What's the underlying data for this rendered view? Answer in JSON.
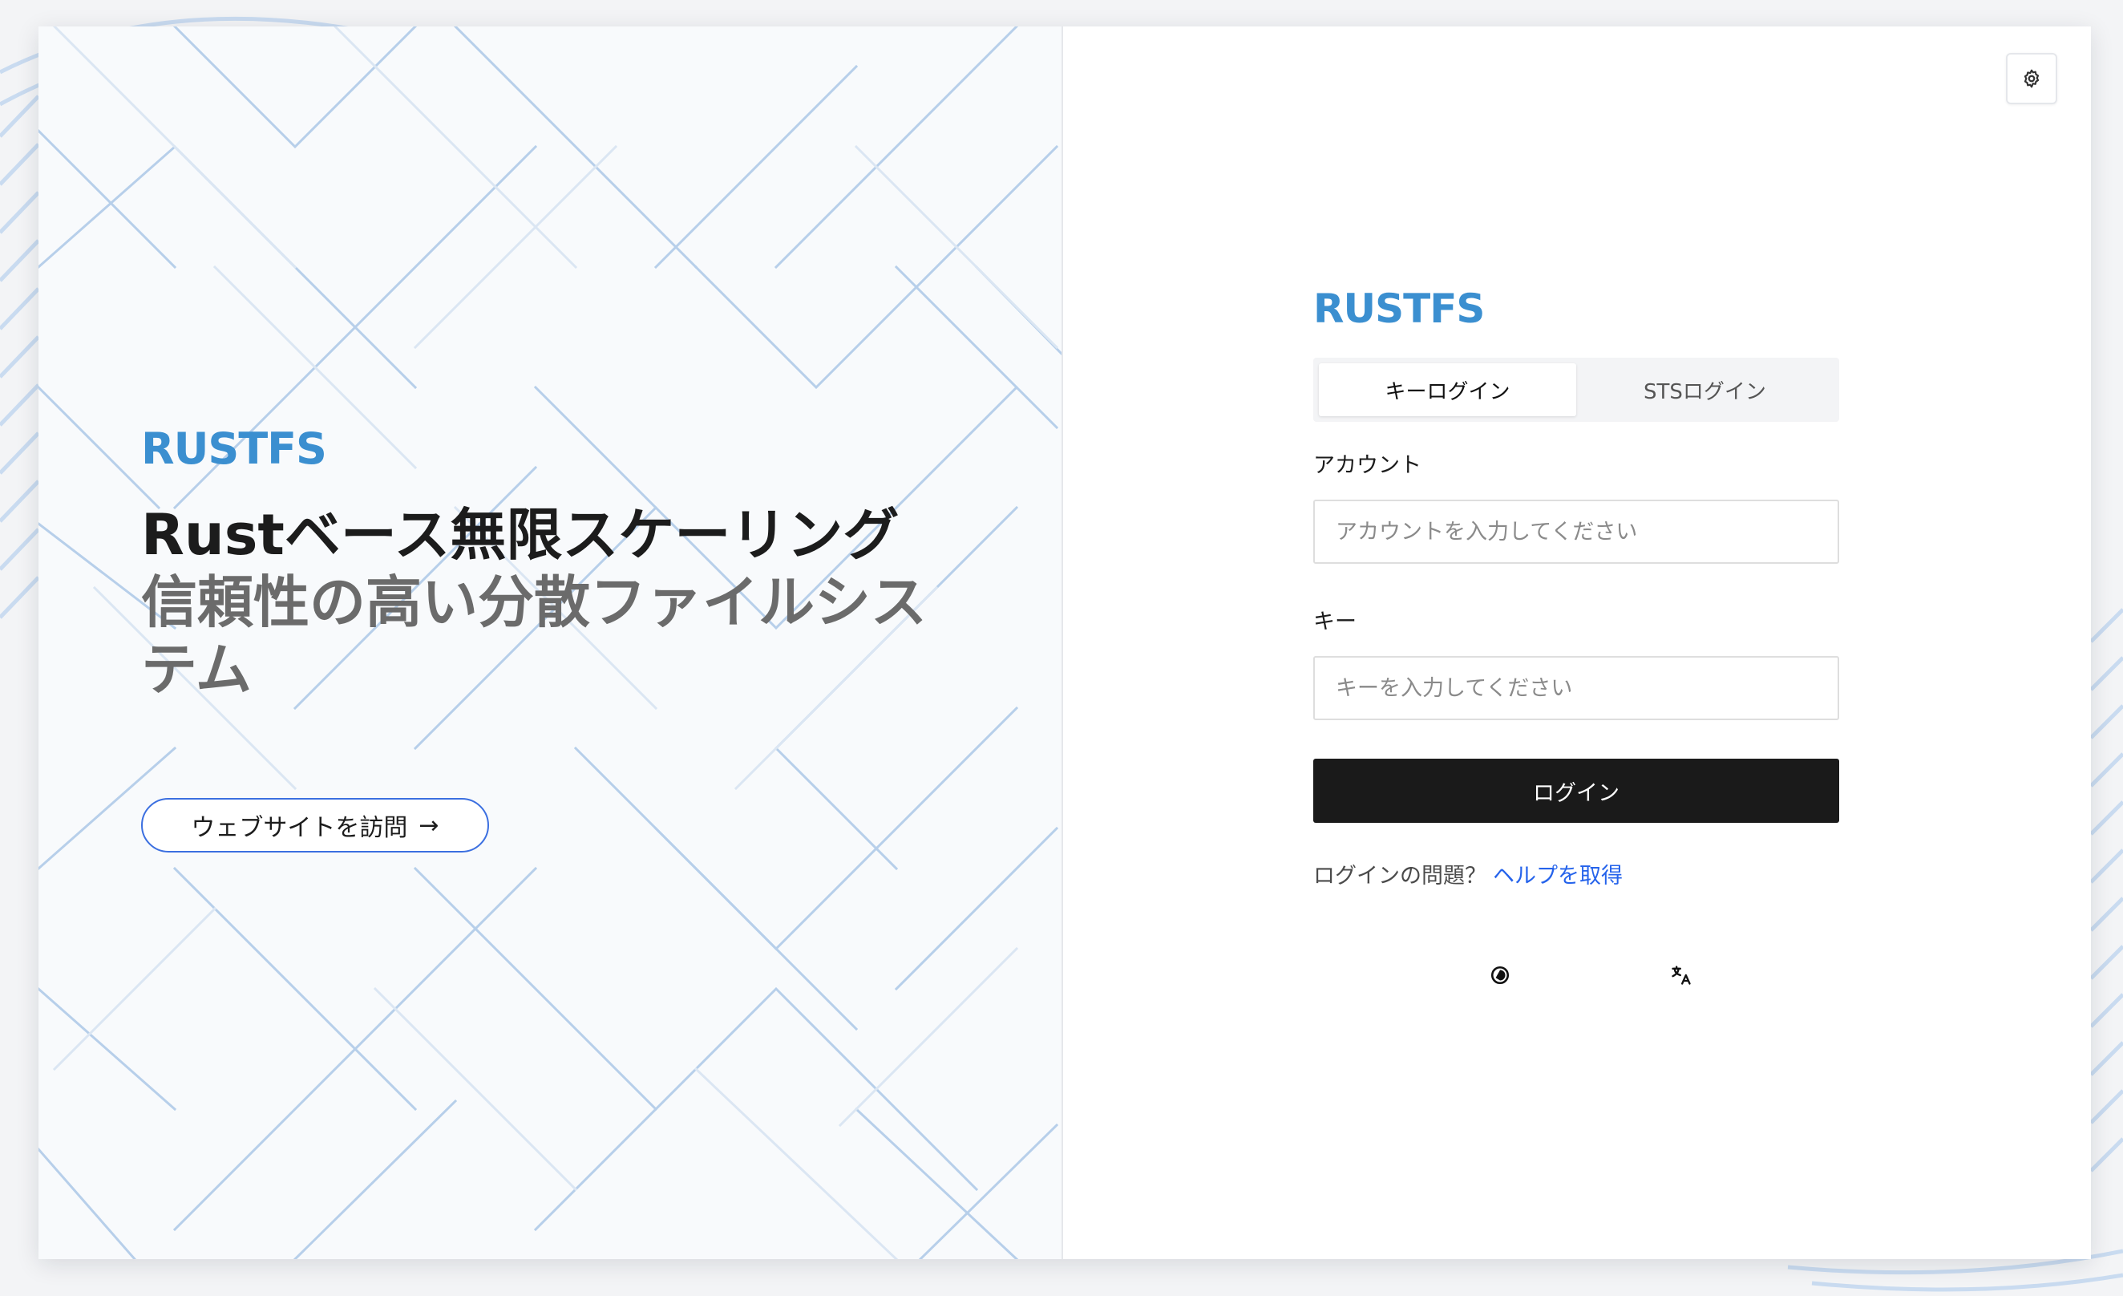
{
  "brand": {
    "name": "RUSTFS",
    "color": "#3b8fd0"
  },
  "hero": {
    "title": "Rustベース無限スケーリング",
    "subtitle": "信頼性の高い分散ファイルシステム",
    "visit_label": "ウェブサイトを訪問",
    "visit_arrow": "→"
  },
  "login": {
    "tabs": [
      {
        "label": "キーログイン",
        "active": true
      },
      {
        "label": "STSログイン",
        "active": false
      }
    ],
    "account": {
      "label": "アカウント",
      "placeholder": "アカウントを入力してください",
      "value": ""
    },
    "key": {
      "label": "キー",
      "placeholder": "キーを入力してください",
      "value": ""
    },
    "submit_label": "ログイン",
    "help_text": "ログインの問題？",
    "help_link": "ヘルプを取得"
  },
  "icons": {
    "settings": "gear-icon",
    "theme": "theme-toggle-icon",
    "language": "translate-icon"
  },
  "colors": {
    "accent": "#2563eb",
    "button_dark": "#1a1a1a",
    "outline_blue": "#3b6fe0"
  }
}
